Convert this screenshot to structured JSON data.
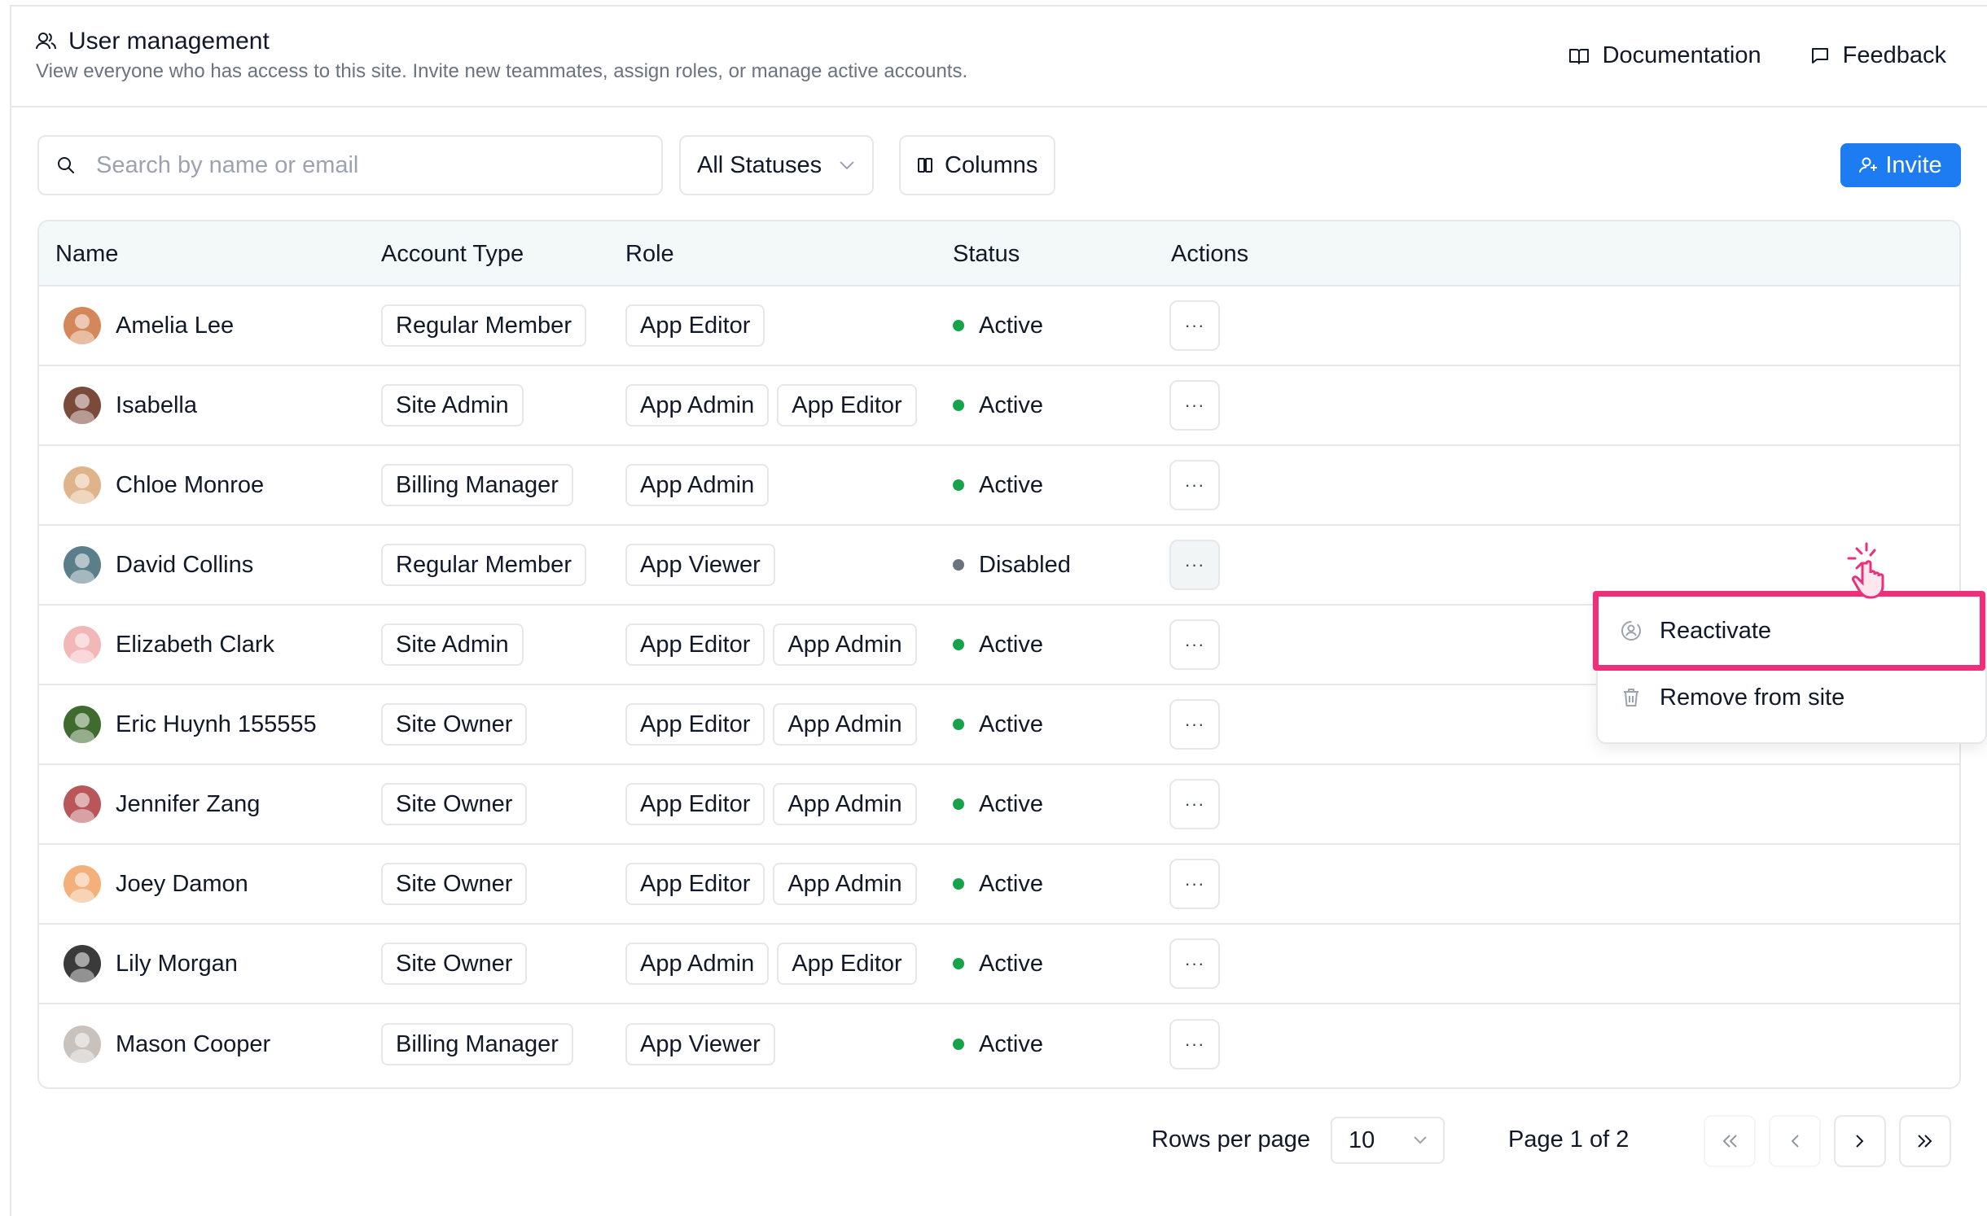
{
  "header": {
    "title": "User management",
    "subtitle": "View everyone who has access to this site. Invite new teammates, assign roles, or manage active accounts.",
    "documentation_label": "Documentation",
    "feedback_label": "Feedback"
  },
  "toolbar": {
    "search_placeholder": "Search by name or email",
    "search_value": "",
    "status_filter": "All Statuses",
    "columns_label": "Columns",
    "invite_label": "Invite"
  },
  "table": {
    "columns": [
      "Name",
      "Account Type",
      "Role",
      "Status",
      "Actions"
    ],
    "rows": [
      {
        "name": "Amelia Lee",
        "account_type": "Regular Member",
        "roles": [
          "App Editor"
        ],
        "status": "Active",
        "avatar_color": "#d4875a"
      },
      {
        "name": "Isabella",
        "account_type": "Site Admin",
        "roles": [
          "App Admin",
          "App Editor"
        ],
        "status": "Active",
        "avatar_color": "#7a4a3a"
      },
      {
        "name": "Chloe Monroe",
        "account_type": "Billing Manager",
        "roles": [
          "App Admin"
        ],
        "status": "Active",
        "avatar_color": "#e0b48a"
      },
      {
        "name": "David Collins",
        "account_type": "Regular Member",
        "roles": [
          "App Viewer"
        ],
        "status": "Disabled",
        "avatar_color": "#5b7f8a"
      },
      {
        "name": "Elizabeth Clark",
        "account_type": "Site Admin",
        "roles": [
          "App Editor",
          "App Admin"
        ],
        "status": "Active",
        "avatar_color": "#f2b8b8"
      },
      {
        "name": "Eric Huynh 155555",
        "account_type": "Site Owner",
        "roles": [
          "App Editor",
          "App Admin"
        ],
        "status": "Active",
        "avatar_color": "#3f6b2e"
      },
      {
        "name": "Jennifer Zang",
        "account_type": "Site Owner",
        "roles": [
          "App Editor",
          "App Admin"
        ],
        "status": "Active",
        "avatar_color": "#b8565a"
      },
      {
        "name": "Joey Damon",
        "account_type": "Site Owner",
        "roles": [
          "App Editor",
          "App Admin"
        ],
        "status": "Active",
        "avatar_color": "#f3b07a"
      },
      {
        "name": "Lily Morgan",
        "account_type": "Site Owner",
        "roles": [
          "App Admin",
          "App Editor"
        ],
        "status": "Active",
        "avatar_color": "#3a3a3a"
      },
      {
        "name": "Mason Cooper",
        "account_type": "Billing Manager",
        "roles": [
          "App Viewer"
        ],
        "status": "Active",
        "avatar_color": "#c9c2bc"
      }
    ],
    "actions_label": "···"
  },
  "menu": {
    "reactivate_label": "Reactivate",
    "remove_label": "Remove from site"
  },
  "pagination": {
    "rows_per_page_label": "Rows per page",
    "rows_per_page_value": "10",
    "page_label": "Page 1 of 2"
  },
  "colors": {
    "accent": "#1d7cf2",
    "active": "#16a34a",
    "disabled": "#6b7280",
    "highlight": "#ef2f7a",
    "header_bg": "#f3f9f9"
  }
}
